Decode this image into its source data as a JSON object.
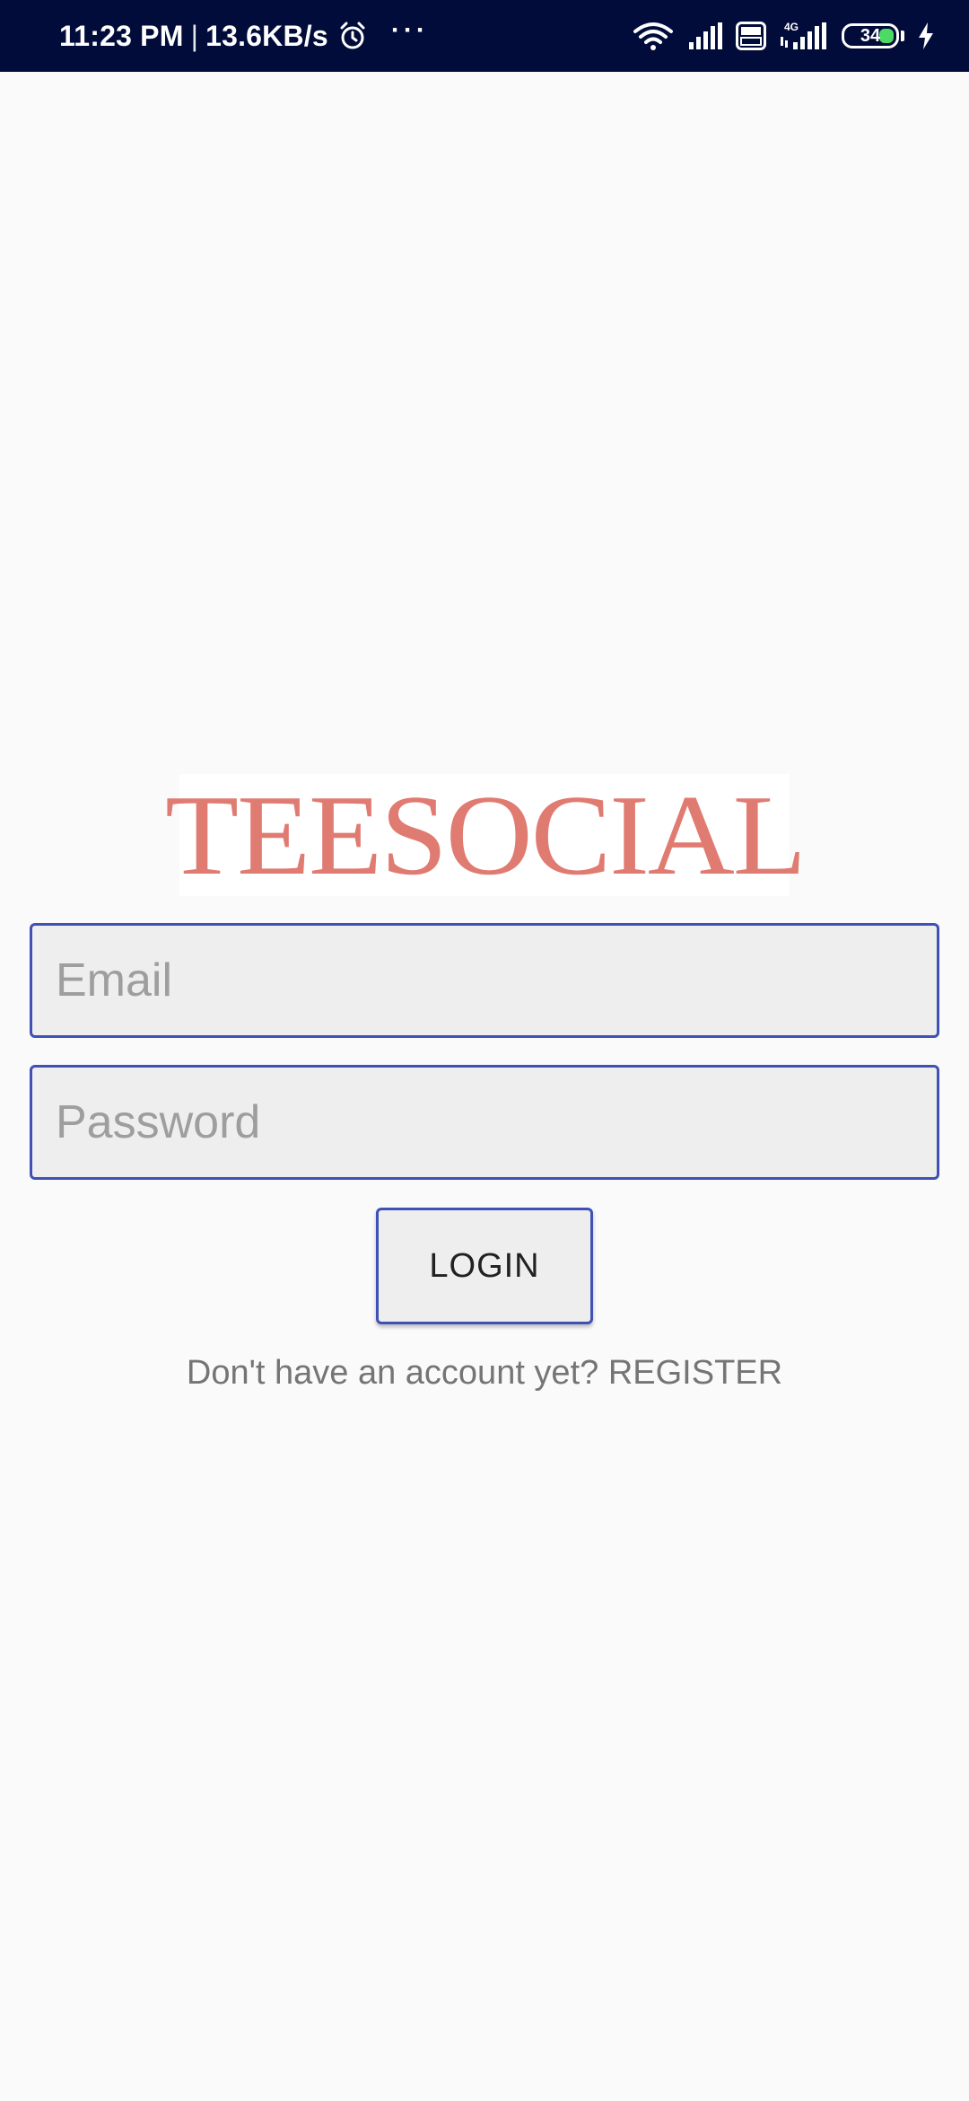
{
  "status_bar": {
    "time": "11:23 PM",
    "separator": "|",
    "network_speed": "13.6KB/s",
    "overflow": "···",
    "network_type": "4G",
    "volte": "Vo LTE",
    "battery_level": "34",
    "icons": [
      "alarm-icon",
      "wifi-icon",
      "signal-icon",
      "volte-icon",
      "signal-4g-icon",
      "battery-icon",
      "charging-icon"
    ]
  },
  "logo": {
    "text": "TEESOCIAL",
    "color": "#e07b72"
  },
  "form": {
    "email_placeholder": "Email",
    "email_value": "",
    "password_placeholder": "Password",
    "password_value": "",
    "login_label": "LOGIN",
    "register_prompt": "Don't have an account yet? REGISTER"
  },
  "colors": {
    "status_bar_bg": "#020c3a",
    "accent": "#3f51b5",
    "background": "#fafafa",
    "battery_fill": "#4cd964"
  }
}
